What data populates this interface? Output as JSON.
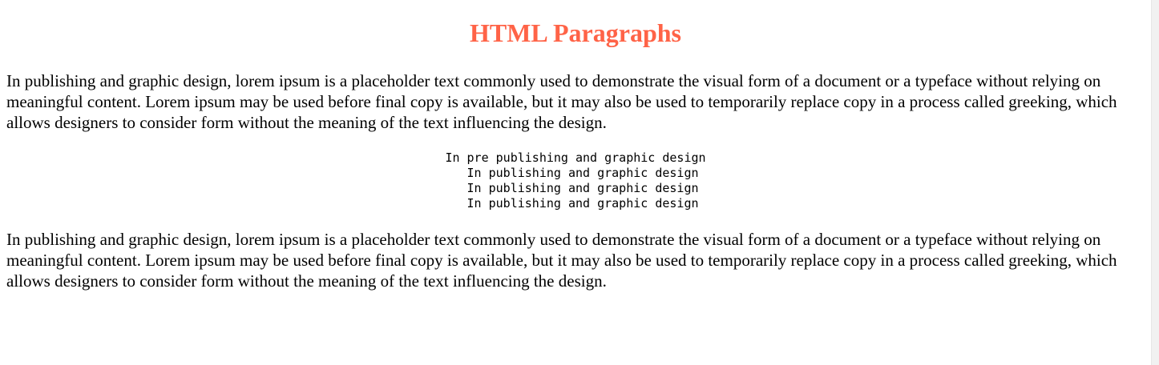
{
  "heading": "HTML Paragraphs",
  "paragraph_1": "In publishing and graphic design, lorem ipsum is a placeholder text commonly used to demonstrate the visual form of a document or a typeface without relying on meaningful content. Lorem ipsum may be used before final copy is available, but it may also be used to temporarily replace copy in a process called greeking, which allows designers to consider form without the meaning of the text influencing the design.",
  "pre_block": "In pre publishing and graphic design\n  In publishing and graphic design\n  In publishing and graphic design\n  In publishing and graphic design",
  "paragraph_2": "In publishing and graphic design, lorem ipsum is a placeholder text commonly used to demonstrate the visual form of a document or a typeface without relying on meaningful content. Lorem ipsum may be used before final copy is available, but it may also be used to temporarily replace copy in a process called greeking, which allows designers to consider form without the meaning of the text influencing the design.",
  "colors": {
    "heading": "#ff6347",
    "text": "#000000",
    "background": "#ffffff"
  }
}
